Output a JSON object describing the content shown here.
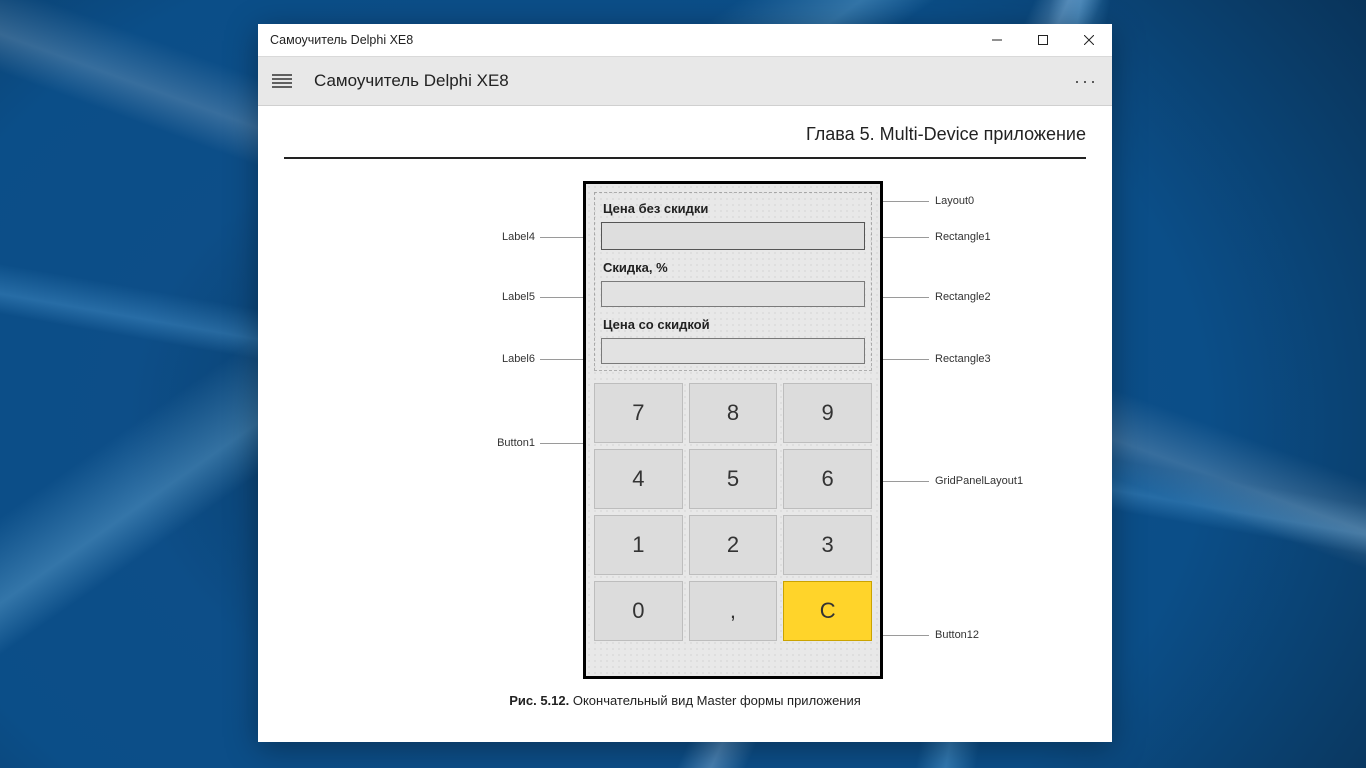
{
  "window": {
    "title": "Самоучитель Delphi XE8"
  },
  "toolbar": {
    "title": "Самоучитель Delphi XE8"
  },
  "chapter": {
    "title": "Глава 5. Multi-Device приложение"
  },
  "figure": {
    "caption_prefix": "Рис. 5.12.",
    "caption_text": " Окончательный вид Master формы приложения"
  },
  "designer": {
    "labels": {
      "price_no_discount": "Цена без скидки",
      "discount_pct": "Скидка, %",
      "price_with_discount": "Цена со скидкой"
    },
    "buttons": [
      "7",
      "8",
      "9",
      "4",
      "5",
      "6",
      "1",
      "2",
      "3",
      "0",
      ",",
      "C"
    ]
  },
  "callouts": {
    "layout0": "Layout0",
    "rectangle1": "Rectangle1",
    "rectangle2": "Rectangle2",
    "rectangle3": "Rectangle3",
    "label4": "Label4",
    "label5": "Label5",
    "label6": "Label6",
    "button1": "Button1",
    "gridpanel": "GridPanelLayout1",
    "button12": "Button12"
  }
}
